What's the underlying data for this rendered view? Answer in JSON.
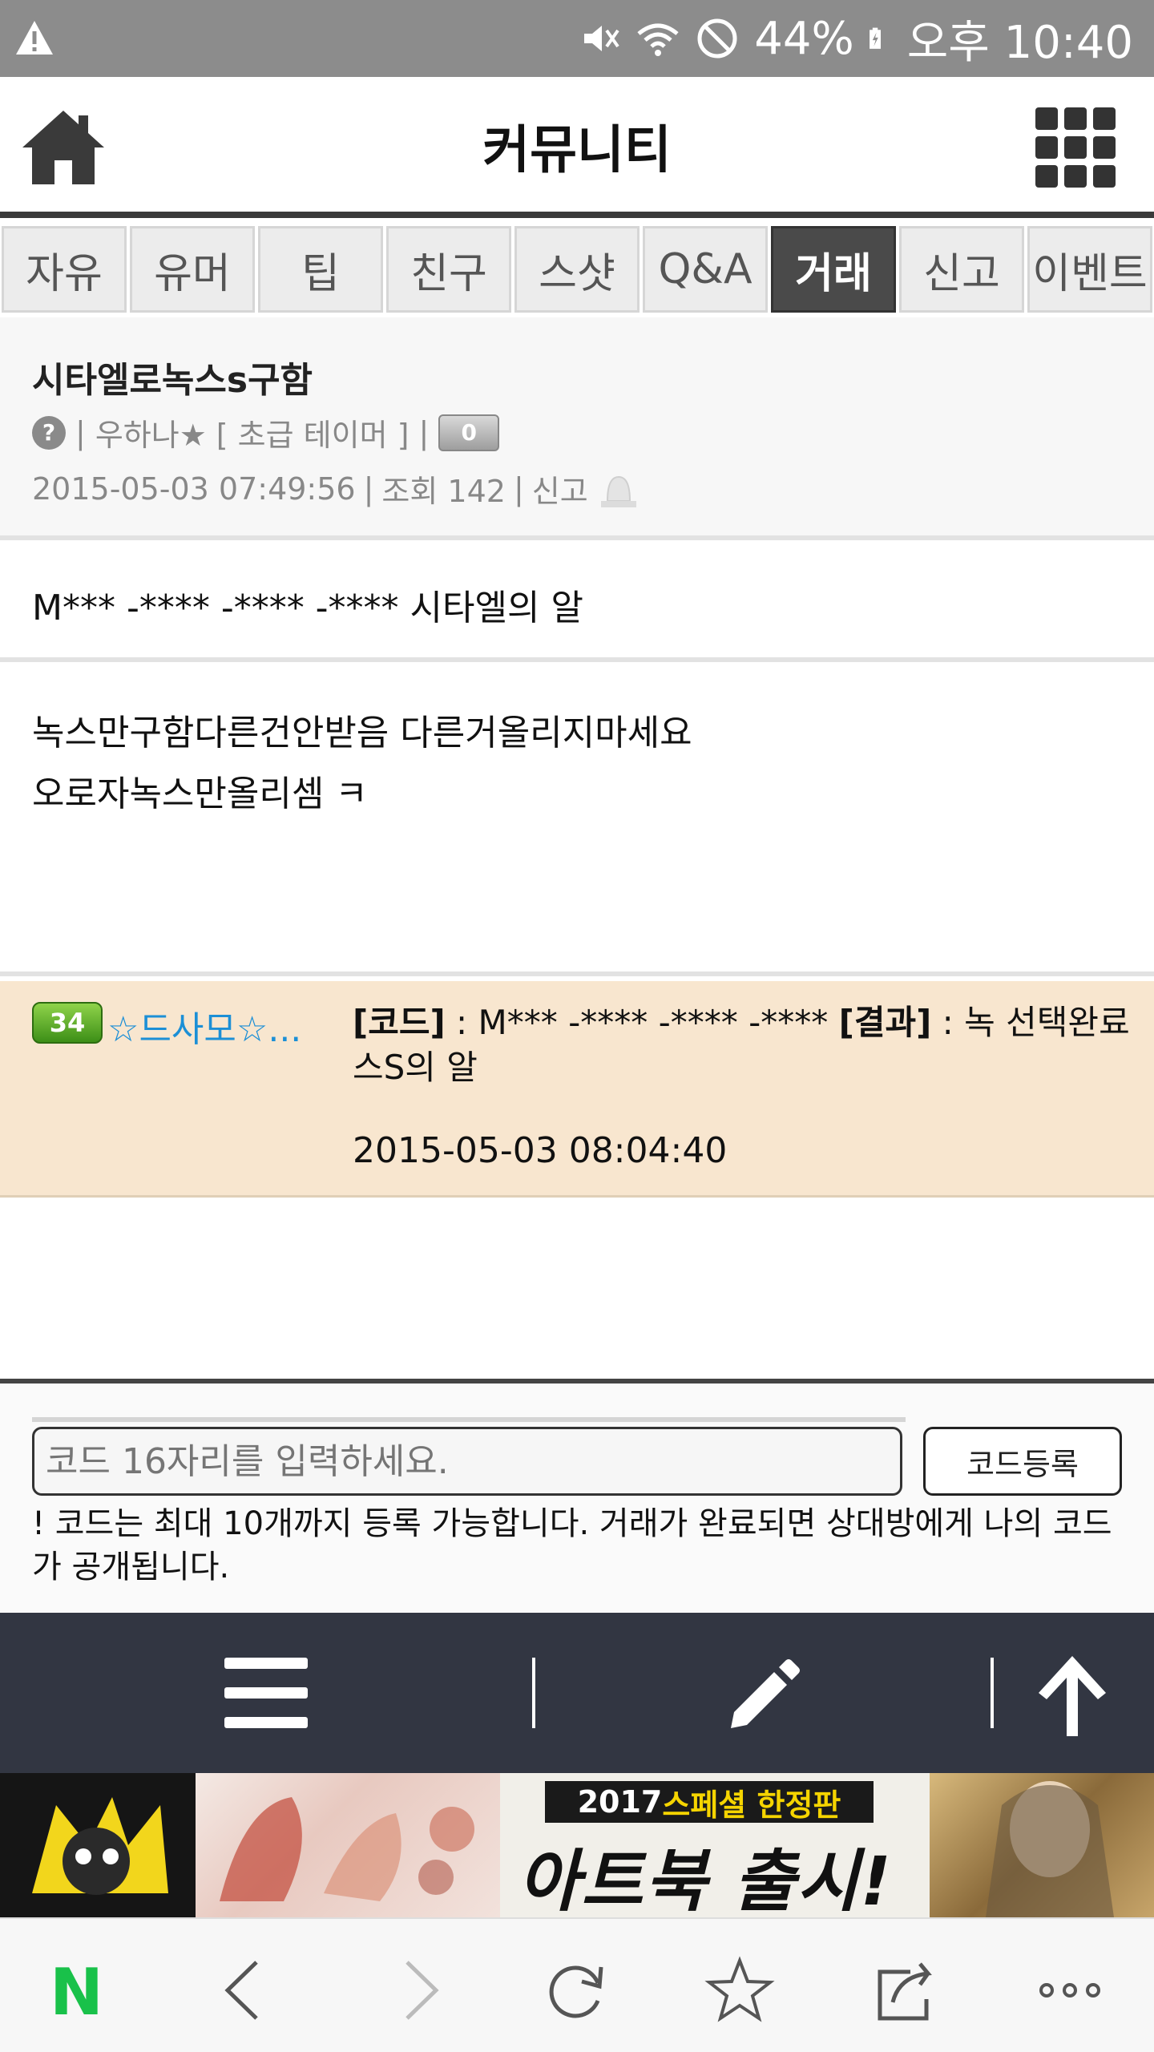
{
  "status_bar": {
    "battery": "44%",
    "time": "오후 10:40",
    "icons": [
      "warning-icon",
      "mute-icon",
      "wifi-icon",
      "blocked-icon",
      "battery-icon"
    ]
  },
  "header": {
    "title": "커뮤니티",
    "home_icon": "home-icon",
    "menu_icon": "grid-icon"
  },
  "tabs": [
    {
      "label": "자유",
      "active": false
    },
    {
      "label": "유머",
      "active": false
    },
    {
      "label": "팁",
      "active": false
    },
    {
      "label": "친구",
      "active": false
    },
    {
      "label": "스샷",
      "active": false
    },
    {
      "label": "Q&A",
      "active": false
    },
    {
      "label": "거래",
      "active": true
    },
    {
      "label": "신고",
      "active": false
    },
    {
      "label": "이벤트",
      "active": false
    }
  ],
  "post": {
    "title": "시타엘로녹스s구함",
    "author": "우하나★",
    "rank": "[ 초급 테이머 ]",
    "sep": "|",
    "count_badge": "0",
    "date": "2015-05-03 07:49:56",
    "views": "조회 142",
    "report": "신고",
    "code_line": "M*** -**** -**** -**** 시타엘의 알",
    "body_lines": [
      "녹스만구함다른건안받음 다른거올리지마세요",
      "오로자녹스만올리셈 ㅋ"
    ]
  },
  "comment": {
    "level": "34",
    "name": "☆드사모☆...",
    "code_label": "[코드]",
    "code_value": " : M*** -**** -**** -**** ",
    "result_label": "[결과]",
    "result_value": " : 녹 선택완료",
    "result_value2": "스S의 알",
    "date": "2015-05-03 08:04:40"
  },
  "code_form": {
    "placeholder": "코드 16자리를 입력하세요.",
    "submit_label": "코드등록",
    "notice": "! 코드는 최대 10개까지 등록 가능합니다. 거래가 완료되면 상대방에게 나의 코드가 공개됩니다."
  },
  "banner": {
    "top_prefix": "2017 ",
    "top_highlight": "스페셜 한정판",
    "headline": "아트북 출시!"
  },
  "browser_bar": {
    "logo": "N",
    "icons": [
      "back-icon",
      "forward-icon",
      "refresh-icon",
      "bookmark-star-icon",
      "share-icon",
      "more-icon"
    ]
  },
  "colors": {
    "status_bar": "#8c8c8c",
    "active_tab": "#4a4a4a",
    "comment_bg": "#f8e6cf",
    "comment_name": "#1c8fd6",
    "toolbar": "#323642",
    "naver_green": "#19c14a"
  }
}
